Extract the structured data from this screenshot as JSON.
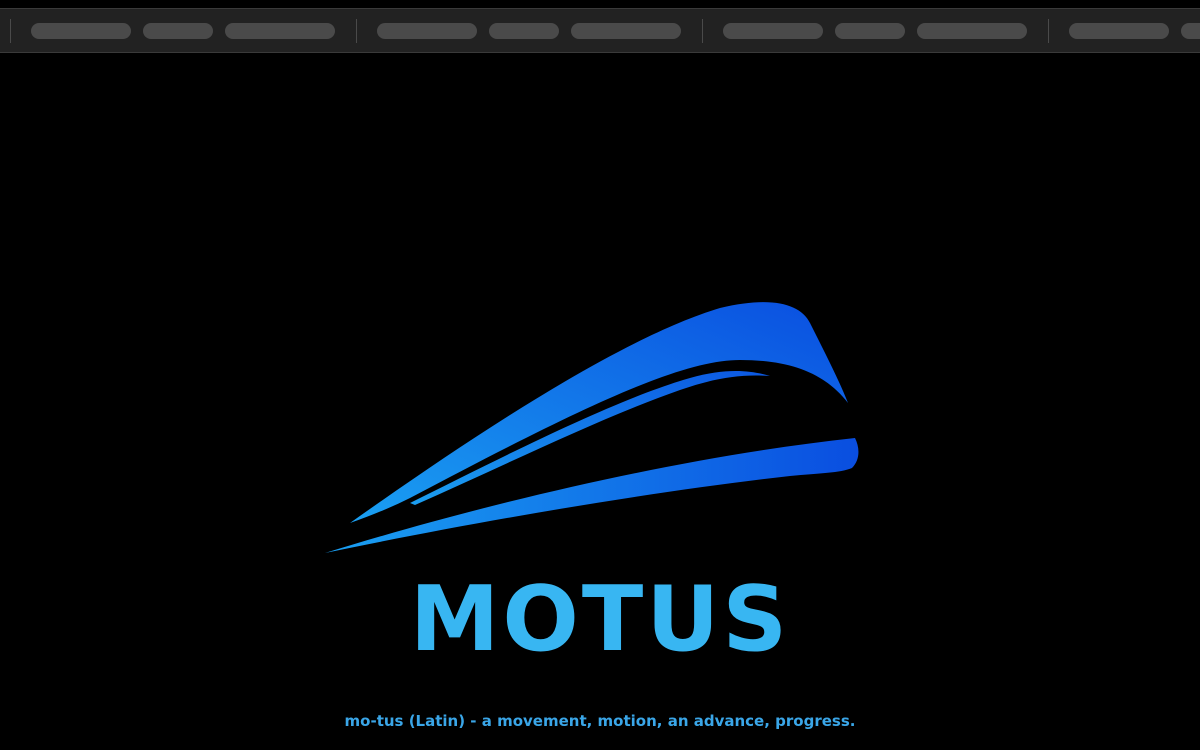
{
  "toolbar": {
    "groups": [
      {
        "items": [
          "",
          "",
          ""
        ]
      },
      {
        "items": [
          "",
          "",
          ""
        ]
      },
      {
        "items": [
          "",
          "",
          ""
        ]
      },
      {
        "items": [
          "",
          ""
        ]
      }
    ]
  },
  "brand": {
    "name": "MOTUS",
    "tagline": "mo-tus (Latin) - a movement, motion, an advance, progress.",
    "logo_icon": "swoosh-train-logo-icon"
  },
  "colors": {
    "background": "#000000",
    "toolbar_bg": "#222222",
    "toolbar_pill": "#4a4a4a",
    "wordmark": "#38b6f2",
    "tagline": "#3aa6e8",
    "logo_gradient_start": "#1aa0f2",
    "logo_gradient_end": "#0a4ee0"
  }
}
